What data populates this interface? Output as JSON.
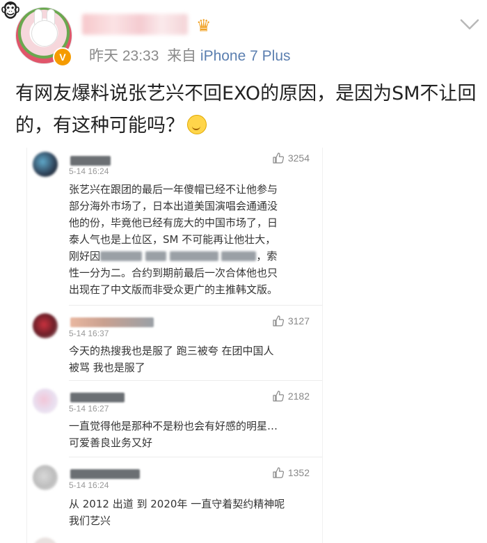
{
  "post": {
    "timestamp": "昨天 23:33",
    "source_prefix": "来自",
    "source_device": "iPhone 7 Plus",
    "text": "有网友爆料说张艺兴不回EXO的原因，是因为SM不让回的，有这种可能吗？",
    "verified_badge": "V",
    "icons": [
      "mascot-icon",
      "crown-icon",
      "chevron-down-icon",
      "verified-icon",
      "emoji-icon"
    ]
  },
  "comments": [
    {
      "time": "5-14 16:24",
      "likes": "3254",
      "lines": [
        "张艺兴在跟团的最后一年傻帽已经不让他参与",
        "部分海外市场了，日本出道美国演唱会通通没",
        "他的份，毕竟他已经有庞大的中国市场了，日",
        "泰人气也是上位区，SM 不可能再让他壮大，",
        "刚好因",
        "性一分为二。合约到期前最后一次合体他也只",
        "出现在了中文版而非受众更广的主推韩文版。"
      ],
      "line5_tail": "，索"
    },
    {
      "time": "5-14 16:37",
      "likes": "3127",
      "lines": [
        "今天的热搜我也是服了 跑三被夸 在团中国人",
        "被骂 我也是服了"
      ]
    },
    {
      "time": "5-14 16:27",
      "likes": "2182",
      "lines": [
        "一直觉得他是那种不是粉也会有好感的明星…",
        "可爱善良业务又好"
      ]
    },
    {
      "time": "5-14 16:24",
      "likes": "1352",
      "lines": [
        "从 2012 出道 到 2020年 一直守着契约精神呢",
        "我们艺兴"
      ]
    }
  ]
}
